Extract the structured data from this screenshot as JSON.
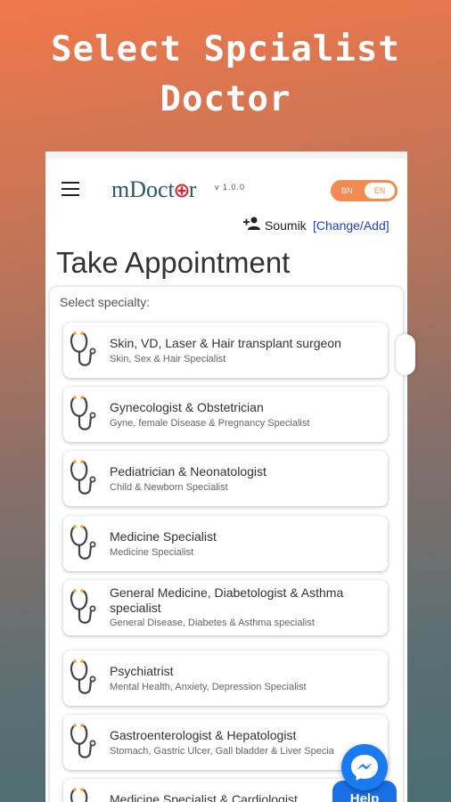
{
  "promo": {
    "line1": "Select Spcialist",
    "line2": "Doctor"
  },
  "app": {
    "logo_text_1": "mDoct",
    "logo_text_2": "r",
    "version": "v 1.0.0",
    "lang_left": "BN",
    "lang_right": "EN",
    "user_name": "Soumik",
    "user_action": "[Change/Add]",
    "page_title": "Take Appointment"
  },
  "specialty": {
    "label": "Select specialty:",
    "items": [
      {
        "title": "Skin, VD, Laser & Hair transplant surgeon",
        "subtitle": "Skin, Sex & Hair  Specialist"
      },
      {
        "title": "Gynecologist & Obstetrician",
        "subtitle": "Gyne, female Disease & Pregnancy Specialist"
      },
      {
        "title": "Pediatrician & Neonatologist",
        "subtitle": "Child & Newborn Specialist"
      },
      {
        "title": "Medicine Specialist",
        "subtitle": "Medicine Specialist"
      },
      {
        "title": "General Medicine, Diabetologist & Asthma specialist",
        "subtitle": "General Disease, Diabetes & Asthma specialist"
      },
      {
        "title": "Psychiatrist",
        "subtitle": "Mental Health, Anxiety, Depression Specialist"
      },
      {
        "title": "Gastroenterologist & Hepatologist",
        "subtitle": "Stomach, Gastric Ulcer, Gall bladder & Liver Specia"
      },
      {
        "title": "Medicine Specialist & Cardiologist",
        "subtitle": ""
      }
    ]
  },
  "help": {
    "label": "Help"
  },
  "icons": {
    "menu": "hamburger-menu-icon",
    "user": "person-add-icon",
    "item": "stethoscope-icon",
    "chat": "messenger-icon"
  },
  "colors": {
    "accent": "#f48a52",
    "link": "#1a3fd6",
    "logo": "#2b5b56",
    "help": "#1a6fe6"
  }
}
